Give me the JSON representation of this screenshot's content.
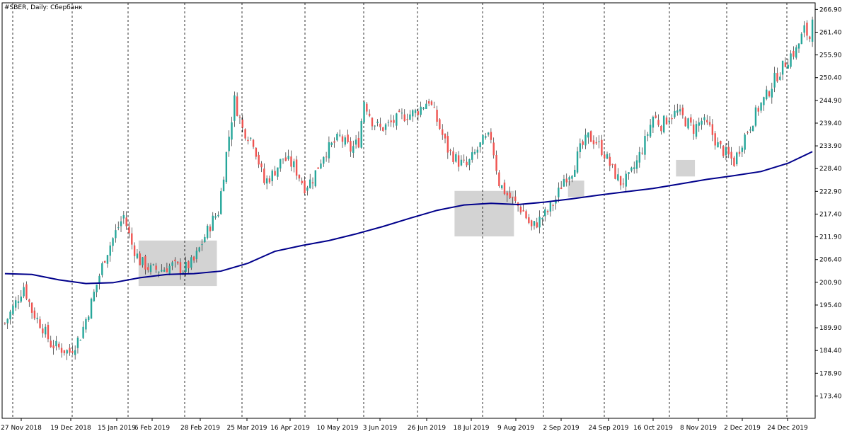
{
  "chart_data": {
    "type": "candlestick",
    "title": "#SBER, Daily:  Сбербанк",
    "ylim": [
      168.0,
      268.5
    ],
    "y_ticks": [
      "266.90",
      "261.40",
      "255.90",
      "250.40",
      "244.90",
      "239.40",
      "233.90",
      "228.40",
      "222.90",
      "217.40",
      "211.90",
      "206.40",
      "200.90",
      "195.40",
      "189.90",
      "184.40",
      "178.90",
      "173.40"
    ],
    "x_ticks": [
      "27 Nov 2018",
      "19 Dec 2018",
      "15 Jan 2019",
      "6 Feb 2019",
      "28 Feb 2019",
      "25 Mar 2019",
      "16 Apr 2019",
      "10 May 2019",
      "3 Jun 2019",
      "26 Jun 2019",
      "18 Jul 2019",
      "9 Aug 2019",
      "2 Sep 2019",
      "24 Sep 2019",
      "16 Oct 2019",
      "8 Nov 2019",
      "2 Dec 2019",
      "24 Dec 2019"
    ],
    "separator_labels": [
      "19 Dec 2018",
      "15 Jan 2019",
      "28 Feb 2019",
      "25 Mar 2019",
      "16 Apr 2019",
      "10 May 2019",
      "3 Jun 2019",
      "26 Jun 2019",
      "18 Jul 2019",
      "2 Sep 2019",
      "24 Sep 2019",
      "16 Oct 2019",
      "2 Dec 2019",
      "24 Dec 2019"
    ],
    "close_path": [
      [
        0,
        191
      ],
      [
        4,
        196
      ],
      [
        7,
        200
      ],
      [
        10,
        194
      ],
      [
        14,
        190
      ],
      [
        17,
        186
      ],
      [
        20,
        185
      ],
      [
        24,
        184
      ],
      [
        28,
        188
      ],
      [
        32,
        196
      ],
      [
        37,
        207
      ],
      [
        41,
        213
      ],
      [
        44,
        217
      ],
      [
        47,
        210
      ],
      [
        50,
        206
      ],
      [
        54,
        204
      ],
      [
        58,
        204
      ],
      [
        62,
        205
      ],
      [
        66,
        204
      ],
      [
        70,
        206
      ],
      [
        74,
        212
      ],
      [
        77,
        216
      ],
      [
        79,
        218
      ],
      [
        82,
        232
      ],
      [
        85,
        245
      ],
      [
        88,
        238
      ],
      [
        92,
        235
      ],
      [
        96,
        225
      ],
      [
        99,
        227
      ],
      [
        103,
        231
      ],
      [
        107,
        229
      ],
      [
        111,
        224
      ],
      [
        114,
        226
      ],
      [
        118,
        232
      ],
      [
        121,
        234
      ],
      [
        124,
        236
      ],
      [
        128,
        233
      ],
      [
        131,
        235
      ],
      [
        133,
        245
      ],
      [
        136,
        240
      ],
      [
        139,
        238
      ],
      [
        142,
        239
      ],
      [
        147,
        241
      ],
      [
        152,
        242
      ],
      [
        157,
        245
      ],
      [
        160,
        240
      ],
      [
        164,
        233
      ],
      [
        168,
        230
      ],
      [
        171,
        229
      ],
      [
        174,
        232
      ],
      [
        177,
        235
      ],
      [
        180,
        236
      ],
      [
        183,
        225
      ],
      [
        186,
        222
      ],
      [
        189,
        220
      ],
      [
        192,
        218
      ],
      [
        195,
        214
      ],
      [
        198,
        216
      ],
      [
        201,
        218
      ],
      [
        204,
        221
      ],
      [
        207,
        226
      ],
      [
        210,
        228
      ],
      [
        213,
        233
      ],
      [
        216,
        236
      ],
      [
        219,
        235
      ],
      [
        222,
        232
      ],
      [
        225,
        228
      ],
      [
        228,
        225
      ],
      [
        231,
        226
      ],
      [
        234,
        230
      ],
      [
        237,
        235
      ],
      [
        240,
        241
      ],
      [
        243,
        239
      ],
      [
        246,
        241
      ],
      [
        249,
        242
      ],
      [
        252,
        240
      ],
      [
        255,
        238
      ],
      [
        258,
        240
      ],
      [
        261,
        238
      ],
      [
        264,
        234
      ],
      [
        267,
        232
      ],
      [
        270,
        230
      ],
      [
        273,
        235
      ],
      [
        276,
        239
      ],
      [
        279,
        243
      ],
      [
        282,
        246
      ],
      [
        285,
        250
      ],
      [
        288,
        253
      ],
      [
        291,
        256
      ],
      [
        293,
        257
      ],
      [
        296,
        262
      ],
      [
        298,
        260
      ],
      [
        299,
        266
      ]
    ],
    "candle_seed": 7,
    "ma_series": {
      "points": [
        [
          0,
          203.0
        ],
        [
          10,
          202.8
        ],
        [
          20,
          201.5
        ],
        [
          30,
          200.6
        ],
        [
          40,
          200.8
        ],
        [
          50,
          202.0
        ],
        [
          60,
          202.8
        ],
        [
          70,
          203.0
        ],
        [
          80,
          203.6
        ],
        [
          90,
          205.5
        ],
        [
          100,
          208.4
        ],
        [
          110,
          209.8
        ],
        [
          120,
          211.0
        ],
        [
          130,
          212.6
        ],
        [
          140,
          214.4
        ],
        [
          150,
          216.4
        ],
        [
          160,
          218.3
        ],
        [
          170,
          219.6
        ],
        [
          180,
          220.0
        ],
        [
          190,
          219.7
        ],
        [
          200,
          220.3
        ],
        [
          210,
          221.1
        ],
        [
          220,
          222.0
        ],
        [
          230,
          222.8
        ],
        [
          240,
          223.6
        ],
        [
          250,
          224.7
        ],
        [
          260,
          225.8
        ],
        [
          270,
          226.7
        ],
        [
          280,
          227.7
        ],
        [
          290,
          229.7
        ],
        [
          299,
          232.5
        ]
      ],
      "color": "#00008b"
    },
    "highlight_zones": [
      {
        "x_from": 50,
        "x_to": 78,
        "y_from": 200.0,
        "y_to": 211.0
      },
      {
        "x_from": 167,
        "x_to": 188,
        "y_from": 212.0,
        "y_to": 223.0
      },
      {
        "x_from": 209,
        "x_to": 214,
        "y_from": 221.5,
        "y_to": 225.5
      },
      {
        "x_from": 249,
        "x_to": 255,
        "y_from": 226.5,
        "y_to": 230.5
      }
    ],
    "colors": {
      "bull": "#26a69a",
      "bear": "#ef5350",
      "wick": "#000000",
      "ma": "#00008b",
      "zone": "#d3d3d3",
      "grid": "#000000"
    }
  }
}
